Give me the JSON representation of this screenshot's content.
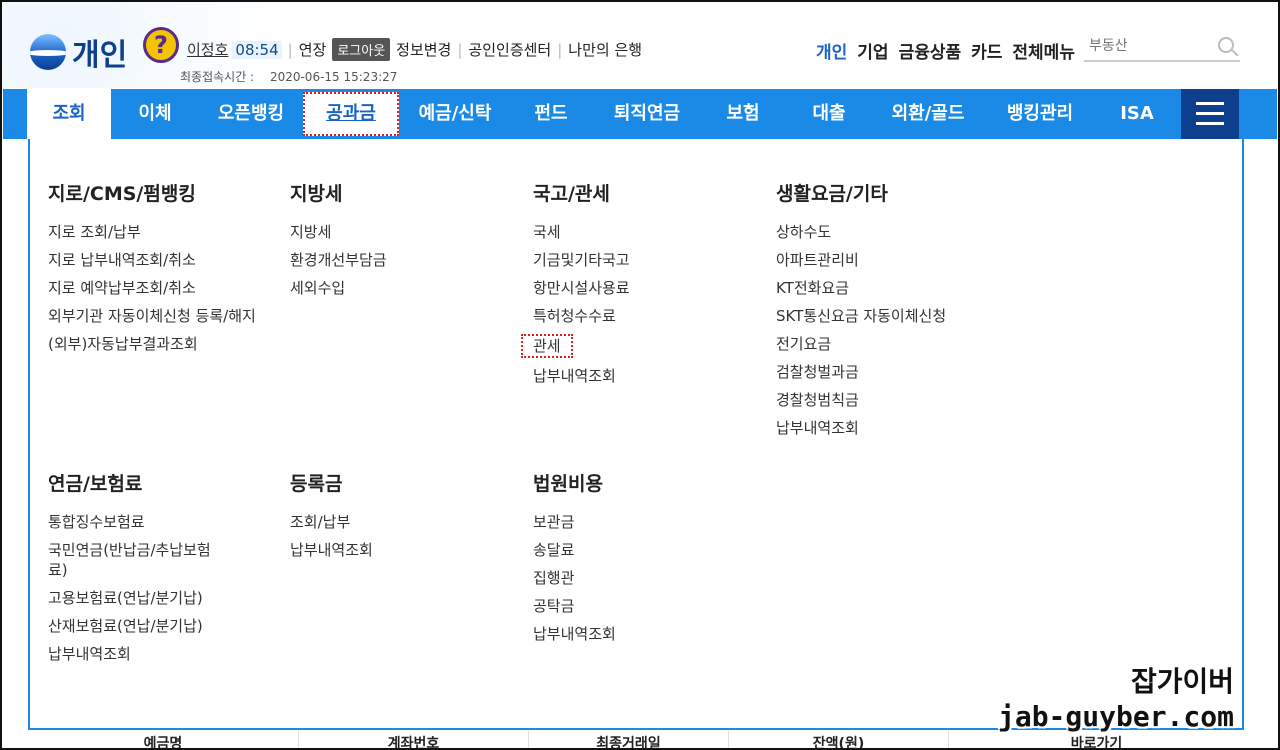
{
  "brand": {
    "label": "개인"
  },
  "user": {
    "name": "이정호",
    "timer": "08:54",
    "extend": "연장",
    "logout": "로그아웃",
    "links": [
      "정보변경",
      "공인인증센터",
      "나만의 은행"
    ]
  },
  "last_login": {
    "label": "최종접속시간 :",
    "value": "2020-06-15 15:23:27"
  },
  "top_nav": [
    "개인",
    "기업",
    "금융상품",
    "카드",
    "전체메뉴"
  ],
  "search": {
    "placeholder": "부동산"
  },
  "main_nav": [
    "조회",
    "이체",
    "오픈뱅킹",
    "공과금",
    "예금/신탁",
    "펀드",
    "퇴직연금",
    "보험",
    "대출",
    "외환/골드",
    "뱅킹관리",
    "ISA"
  ],
  "menu": {
    "col1": {
      "title": "지로/CMS/펌뱅킹",
      "items": [
        "지로 조회/납부",
        "지로 납부내역조회/취소",
        "지로 예약납부조회/취소",
        "외부기관 자동이체신청 등록/해지",
        "(외부)자동납부결과조회"
      ]
    },
    "col2": {
      "title": "지방세",
      "items": [
        "지방세",
        "환경개선부담금",
        "세외수입"
      ]
    },
    "col3": {
      "title": "국고/관세",
      "items": [
        "국세",
        "기금및기타국고",
        "항만시설사용료",
        "특허청수수료",
        "관세",
        "납부내역조회"
      ]
    },
    "col4": {
      "title": "생활요금/기타",
      "items": [
        "상하수도",
        "아파트관리비",
        "KT전화요금",
        "SKT통신요금 자동이체신청",
        "전기요금",
        "검찰청벌과금",
        "경찰청범칙금",
        "납부내역조회"
      ]
    },
    "col5": {
      "title": "연금/보험료",
      "items": [
        "통합징수보험료",
        "국민연금(반납금/추납보험료)",
        "고용보험료(연납/분기납)",
        "산재보험료(연납/분기납)",
        "납부내역조회"
      ]
    },
    "col6": {
      "title": "등록금",
      "items": [
        "조회/납부",
        "납부내역조회"
      ]
    },
    "col7": {
      "title": "법원비용",
      "items": [
        "보관금",
        "송달료",
        "집행관",
        "공탁금",
        "납부내역조회"
      ]
    }
  },
  "watermark": {
    "ko": "잡가이버",
    "en": "jab-guyber.com"
  },
  "table_headers": [
    "예금명",
    "계좌번호",
    "최종거래일",
    "잔액(원)",
    "바로가기"
  ]
}
